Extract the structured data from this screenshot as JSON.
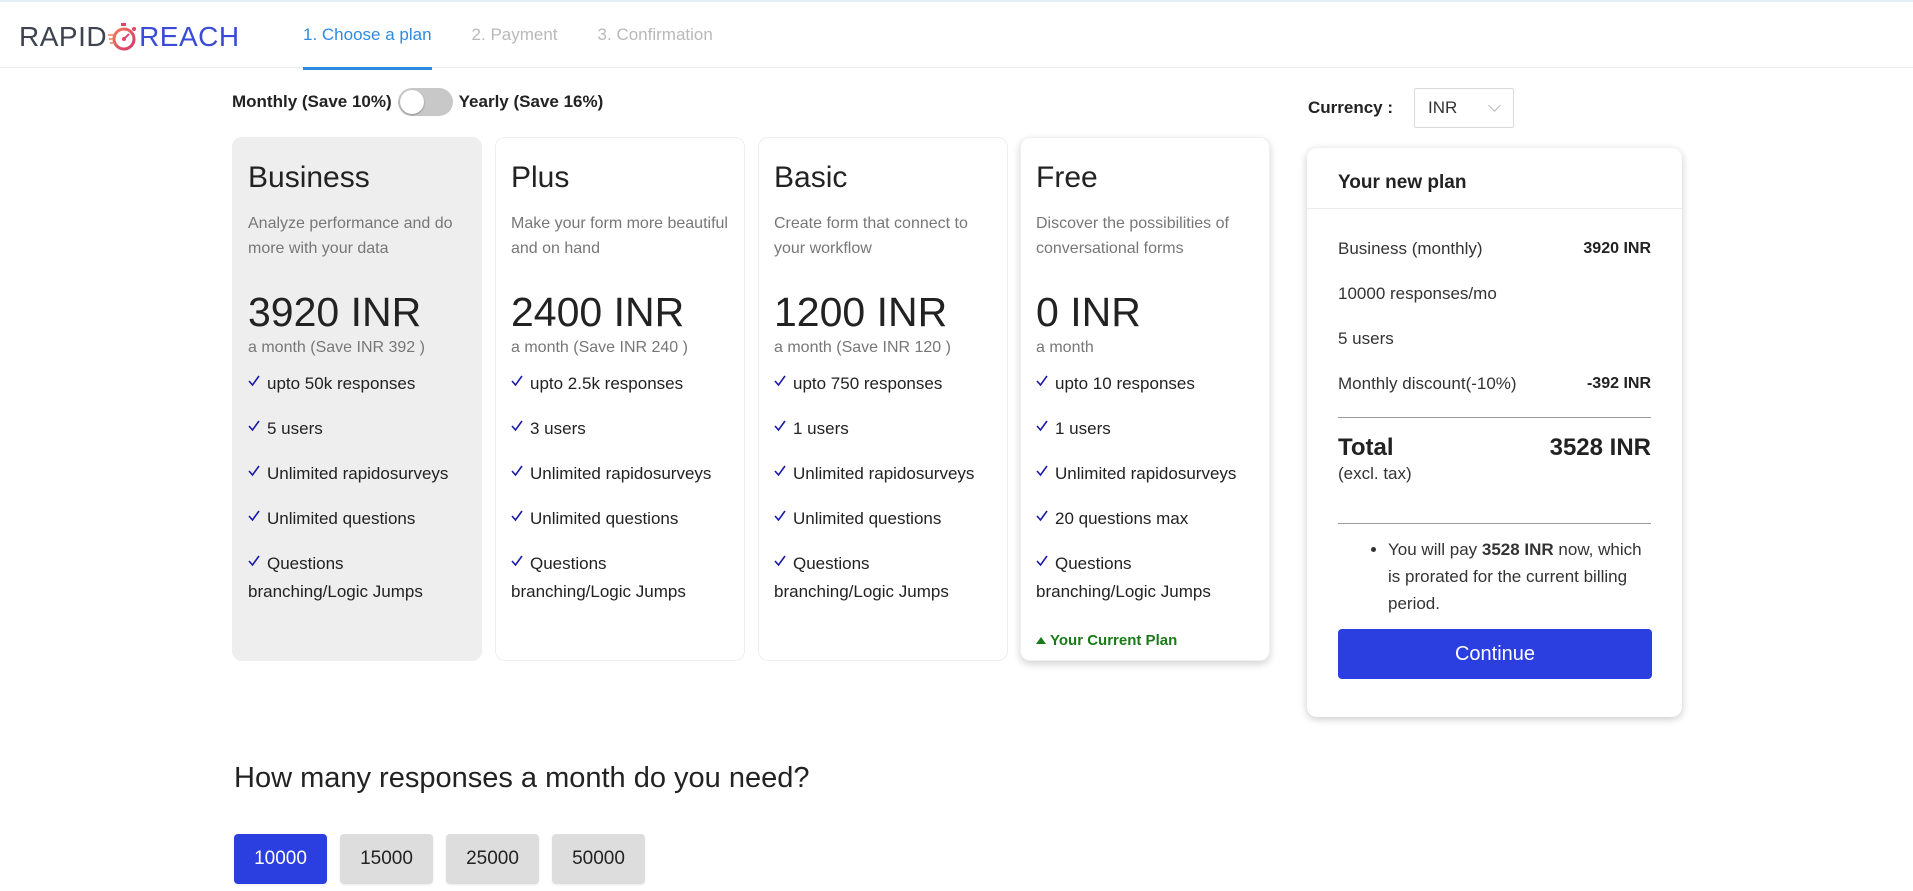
{
  "brand": {
    "left": "RAPID",
    "right": "REACH",
    "left_color": "#3d4450",
    "right_color": "#3a4bd6",
    "icon": "stopwatch-icon"
  },
  "steps": [
    {
      "label": "1. Choose a plan",
      "active": true
    },
    {
      "label": "2. Payment",
      "active": false
    },
    {
      "label": "3. Confirmation",
      "active": false
    }
  ],
  "billing": {
    "monthly_label": "Monthly (Save 10%)",
    "yearly_label": "Yearly (Save 16%)",
    "selected": "monthly"
  },
  "currency": {
    "label": "Currency :",
    "value": "INR"
  },
  "plans": [
    {
      "name": "Business",
      "description": "Analyze performance and do more with your data",
      "price": "3920 INR",
      "period": "a month (Save INR 392 )",
      "features": [
        "upto 50k responses",
        "5 users",
        "Unlimited rapidosurveys",
        "Unlimited questions",
        "Questions branching/Logic Jumps"
      ],
      "selected": true
    },
    {
      "name": "Plus",
      "description": "Make your form more beautiful and on hand",
      "price": "2400 INR",
      "period": "a month (Save INR 240 )",
      "features": [
        "upto 2.5k responses",
        "3 users",
        "Unlimited rapidosurveys",
        "Unlimited questions",
        "Questions branching/Logic Jumps"
      ]
    },
    {
      "name": "Basic",
      "description": "Create form that connect to your workflow",
      "price": "1200 INR",
      "period": "a month (Save INR 120 )",
      "features": [
        "upto 750 responses",
        "1 users",
        "Unlimited rapidosurveys",
        "Unlimited questions",
        "Questions branching/Logic Jumps"
      ]
    },
    {
      "name": "Free",
      "description": "Discover the possibilities of conversational forms",
      "price": "0 INR",
      "period": "a month",
      "features": [
        "upto 10 responses",
        "1 users",
        "Unlimited rapidosurveys",
        "20 questions max",
        "Questions branching/Logic Jumps"
      ],
      "current_label": "Your Current Plan"
    }
  ],
  "summary": {
    "title": "Your new plan",
    "rows": [
      {
        "label": "Business (monthly)",
        "value": "3920 INR"
      },
      {
        "label": "10000 responses/mo",
        "value": ""
      },
      {
        "label": "5 users",
        "value": ""
      },
      {
        "label": "Monthly discount(-10%)",
        "value": "-392 INR"
      }
    ],
    "total_label": "Total",
    "total_value": "3528 INR",
    "total_note": "(excl. tax)",
    "pay_prefix": "You will pay ",
    "pay_amount": "3528 INR",
    "pay_suffix": " now, which is prorated for the current billing period.",
    "continue_label": "Continue"
  },
  "responses": {
    "question": "How many responses a month do you need?",
    "options": [
      "10000",
      "15000",
      "25000",
      "50000"
    ],
    "selected": "10000"
  },
  "colors": {
    "accent": "#2b3fe0",
    "tab_active": "#2f8be0",
    "current_plan": "#1a7a1a",
    "check": "#1a1aa8"
  }
}
